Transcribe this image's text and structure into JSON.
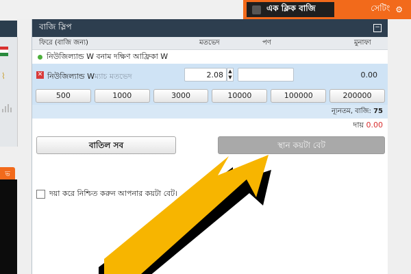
{
  "topbar": {
    "one_click_label": "এক ক্লিক বাজি",
    "settings_label": "সেটিং"
  },
  "left": {
    "orange_button_label": "ভ"
  },
  "slip": {
    "title": "বাজি স্লিপ",
    "columns": {
      "back_for": "ফিরে (বাজি জন্য)",
      "odds": "মতভেদ",
      "stake": "পণ",
      "profit": "মুনাফা"
    },
    "market_name": "নিউজিল্যান্ড W বনাম দক্ষিণ আফ্রিকা W",
    "selection": {
      "name": "নিউজিল্যান্ড W",
      "market_type": "ম্যাচ মতভেদ",
      "odds": "2.08",
      "stake": "",
      "profit": "0.00"
    },
    "quick_stakes": [
      "500",
      "1000",
      "3000",
      "10000",
      "100000",
      "200000"
    ],
    "min_bet_label": "ন্যূনতম, বাজি:",
    "min_bet_value": "75",
    "liability_label": "দায়",
    "liability_value": "0.00",
    "cancel_all_label": "বাতিল সব",
    "place_bets_label": "স্থান কয়টা বেট",
    "confirm_label": "দয়া করে নিশ্চিত করুন আপনার কয়টা বেট।"
  },
  "colors": {
    "accent_orange": "#f26a1b",
    "header_dark": "#2d3e4f",
    "selection_blue": "#cfe3f5",
    "arrow_yellow": "#f7b500",
    "liability_red": "#d82d2d"
  }
}
